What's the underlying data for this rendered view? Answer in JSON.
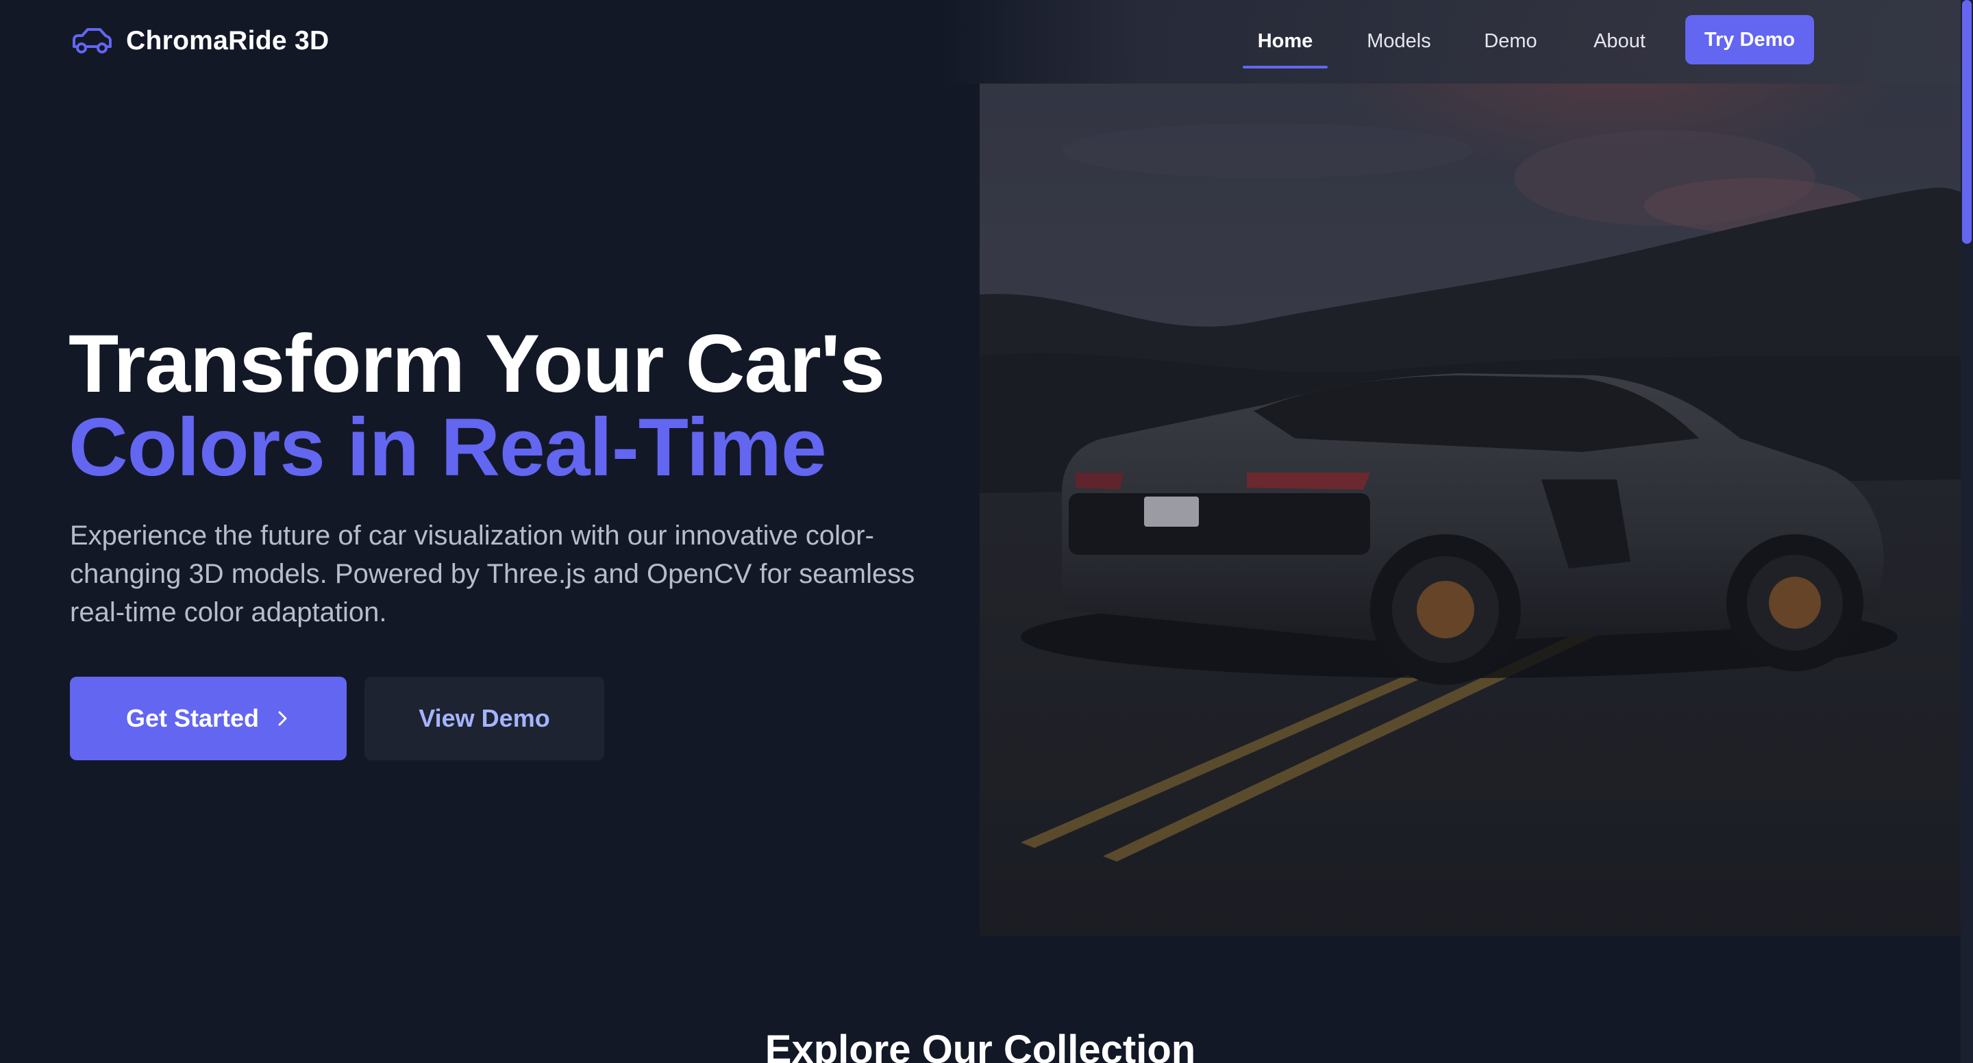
{
  "brand": {
    "name": "ChromaRide 3D",
    "icon": "car-icon",
    "accent_color": "#6366f1"
  },
  "nav": {
    "items": [
      {
        "label": "Home",
        "active": true
      },
      {
        "label": "Models",
        "active": false
      },
      {
        "label": "Demo",
        "active": false
      },
      {
        "label": "About",
        "active": false
      }
    ],
    "cta_label": "Try Demo"
  },
  "hero": {
    "title_line1": "Transform Your Car's",
    "title_line2": "Colors in Real-Time",
    "description": "Experience the future of car visualization with our innovative color-changing 3D models. Powered by Three.js and OpenCV for seamless real-time color adaptation.",
    "primary_button": "Get Started",
    "primary_button_icon": "chevron-right-icon",
    "secondary_button": "View Demo",
    "image": "sports-car-on-road-at-dusk"
  },
  "sections": {
    "collection_title": "Explore Our Collection"
  },
  "colors": {
    "background": "#131827",
    "accent": "#6366f1",
    "secondary_button_bg": "#1e2332",
    "secondary_button_text": "#a5b4fc",
    "body_text": "#b9bdcb"
  }
}
